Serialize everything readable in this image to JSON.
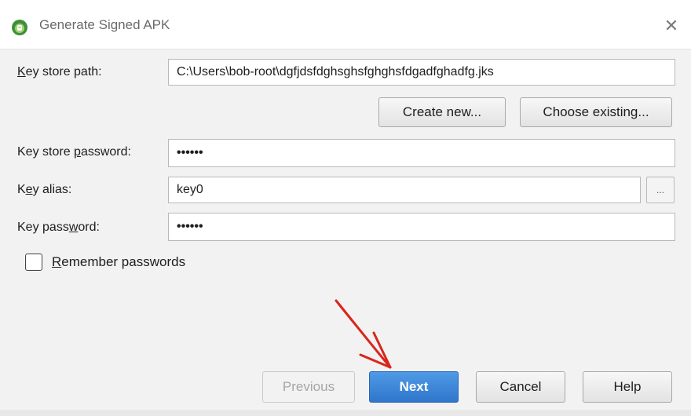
{
  "window": {
    "title": "Generate Signed APK",
    "icon": "android-studio-icon",
    "close_icon": "close-icon",
    "close_glyph": "✕"
  },
  "form": {
    "key_store_path": {
      "label_pre": "",
      "label_ul": "K",
      "label_post": "ey store path:",
      "value": "C:\\Users\\bob-root\\dgfjdsfdghsghsfghghsfdgadfghadfg.jks"
    },
    "create_new_label": "Create new...",
    "choose_existing_label": "Choose existing...",
    "key_store_password": {
      "label_pre": "Key store ",
      "label_ul": "p",
      "label_post": "assword:",
      "value": "••••••"
    },
    "key_alias": {
      "label_pre": "K",
      "label_ul": "e",
      "label_post": "y alias:",
      "value": "key0",
      "browse_label": "..."
    },
    "key_password": {
      "label_pre": "Key pass",
      "label_ul": "w",
      "label_post": "ord:",
      "value": "••••••"
    },
    "remember_passwords": {
      "label_ul": "R",
      "label_post": "emember passwords",
      "checked": false
    }
  },
  "buttons": {
    "previous": "Previous",
    "next": "Next",
    "cancel": "Cancel",
    "help": "Help"
  },
  "colors": {
    "primary_button": "#3683d6",
    "annotation_arrow": "#d9261c"
  }
}
